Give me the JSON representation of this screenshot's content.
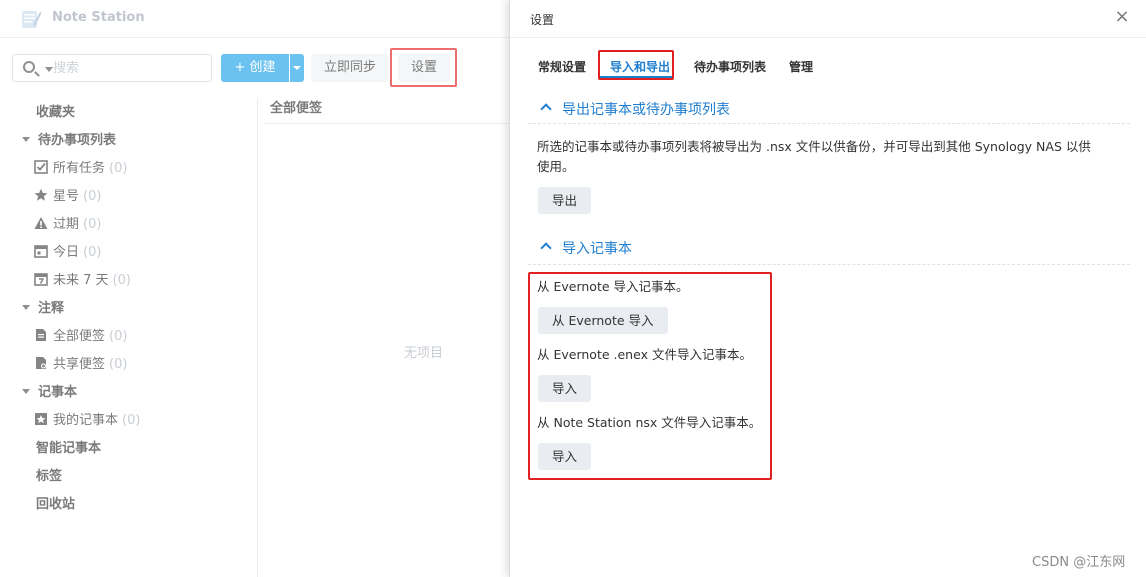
{
  "app": {
    "title": "Note Station",
    "search_placeholder": "搜索",
    "create_label": "+ 创建",
    "sync_label": "立即同步",
    "settings_label": "设置"
  },
  "sidebar": {
    "favorites": "收藏夹",
    "todo_header": "待办事项列表",
    "todo_items": [
      {
        "label": "所有任务",
        "count": "(0)",
        "icon": "checkbox-icon"
      },
      {
        "label": "星号",
        "count": "(0)",
        "icon": "star-icon"
      },
      {
        "label": "过期",
        "count": "(0)",
        "icon": "warning-icon"
      },
      {
        "label": "今日",
        "count": "(0)",
        "icon": "calendar-icon"
      },
      {
        "label": "未来 7 天",
        "count": "(0)",
        "icon": "calendar-7-icon"
      }
    ],
    "notes_header": "注释",
    "notes_items": [
      {
        "label": "全部便签",
        "count": "(0)",
        "icon": "note-icon"
      },
      {
        "label": "共享便签",
        "count": "(0)",
        "icon": "shared-note-icon"
      }
    ],
    "notebook_header": "记事本",
    "notebook_items": [
      {
        "label": "我的记事本",
        "count": "(0)",
        "icon": "notebook-icon"
      }
    ],
    "smart_notebook": "智能记事本",
    "tags": "标签",
    "trash": "回收站"
  },
  "list": {
    "header": "全部便签",
    "empty": "无项目"
  },
  "panel": {
    "title": "设置",
    "close_glyph": "×",
    "tabs": [
      {
        "label": "常规设置"
      },
      {
        "label": "导入和导出"
      },
      {
        "label": "待办事项列表"
      },
      {
        "label": "管理"
      }
    ],
    "export_section": {
      "title": "导出记事本或待办事项列表",
      "desc_line1": "所选的记事本或待办事项列表将被导出为 .nsx 文件以供备份，并可导出到其他 Synology NAS 以供",
      "desc_line2": "使用。",
      "button": "导出"
    },
    "import_section": {
      "title": "导入记事本",
      "evernote_desc": "从 Evernote 导入记事本。",
      "evernote_button": "从 Evernote 导入",
      "enex_desc": "从 Evernote .enex 文件导入记事本。",
      "enex_button": "导入",
      "nsx_desc": "从 Note Station nsx 文件导入记事本。",
      "nsx_button": "导入"
    }
  },
  "watermark": "CSDN @江东网",
  "colors": {
    "accent": "#1f7ecf",
    "create_button": "#1da1e8",
    "highlight": "#e02020"
  }
}
